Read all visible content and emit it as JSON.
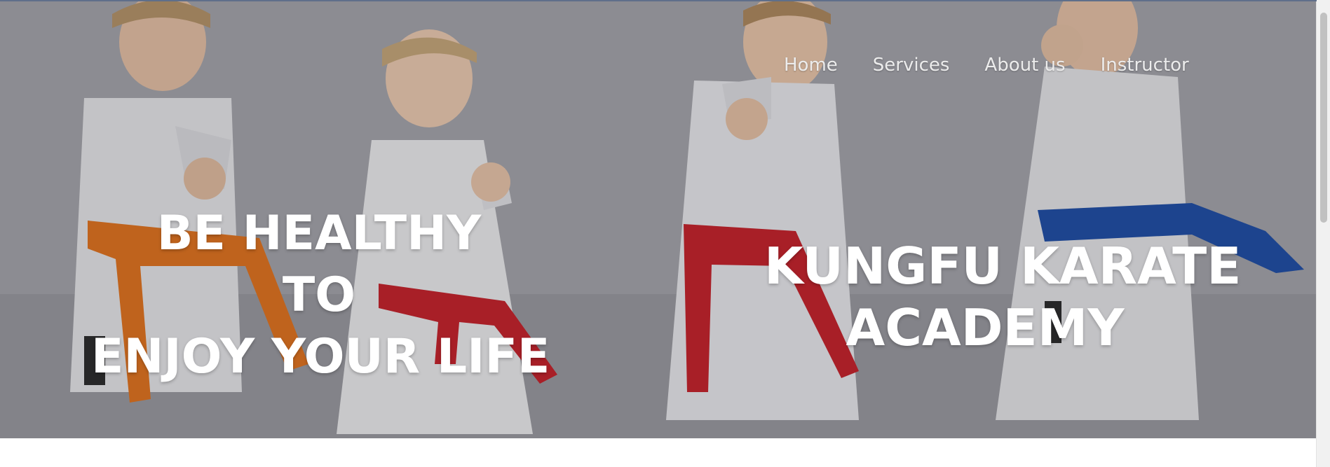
{
  "nav": {
    "items": [
      {
        "label": "Home"
      },
      {
        "label": "Services"
      },
      {
        "label": "About us"
      },
      {
        "label": "Instructor"
      }
    ]
  },
  "hero": {
    "left_headline": [
      "BE HEALTHY",
      "TO",
      "ENJOY YOUR LIFE"
    ],
    "right_headline": [
      "KUNGFU KARATE",
      "ACADEMY"
    ],
    "image_subject": "children in karate uniforms with colored belts punching"
  },
  "colors": {
    "nav_text": "#ececec",
    "headline_text": "#ffffff",
    "belt_orange": "#e4741e",
    "belt_red": "#c8222a",
    "belt_blue": "#1f4fa8"
  }
}
